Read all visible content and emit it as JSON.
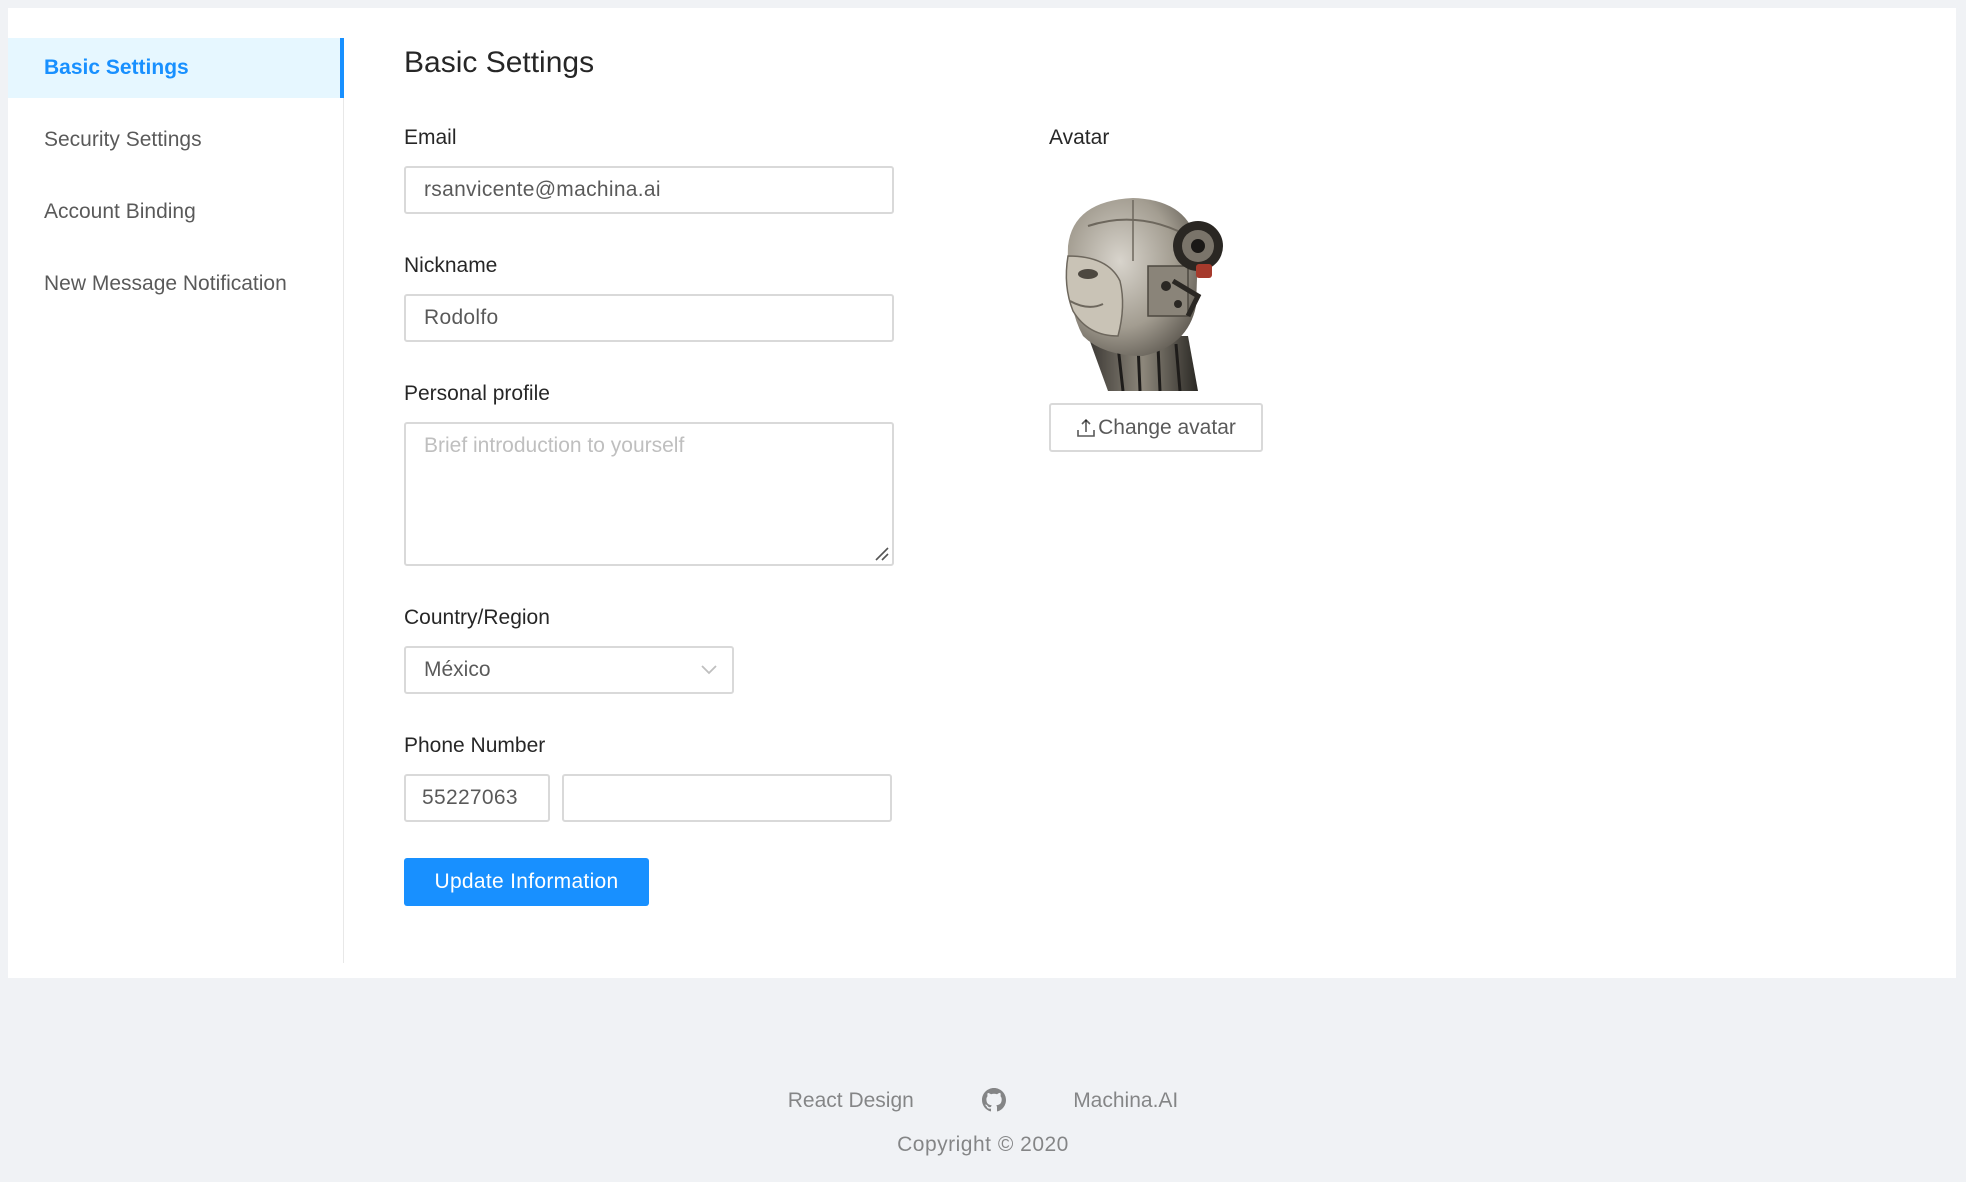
{
  "sidebar": {
    "items": [
      {
        "label": "Basic Settings",
        "active": true
      },
      {
        "label": "Security Settings",
        "active": false
      },
      {
        "label": "Account Binding",
        "active": false
      },
      {
        "label": "New Message Notification",
        "active": false
      }
    ]
  },
  "main": {
    "title": "Basic Settings",
    "email": {
      "label": "Email",
      "value": "rsanvicente@machina.ai"
    },
    "nickname": {
      "label": "Nickname",
      "value": "Rodolfo"
    },
    "profile": {
      "label": "Personal profile",
      "placeholder": "Brief introduction to yourself",
      "value": ""
    },
    "country": {
      "label": "Country/Region",
      "value": "México"
    },
    "phone": {
      "label": "Phone Number",
      "area_code": "55227063",
      "number": ""
    },
    "submit_label": "Update Information"
  },
  "avatar": {
    "label": "Avatar",
    "change_label": "Change avatar",
    "icon": "upload-icon"
  },
  "footer": {
    "links": [
      "React Design",
      "Machina.AI"
    ],
    "github_icon": "github-icon",
    "copyright": "Copyright © 2020"
  },
  "colors": {
    "primary": "#1890ff",
    "active_bg": "#e6f7ff",
    "page_bg": "#f0f2f5",
    "border": "#d9d9d9"
  }
}
